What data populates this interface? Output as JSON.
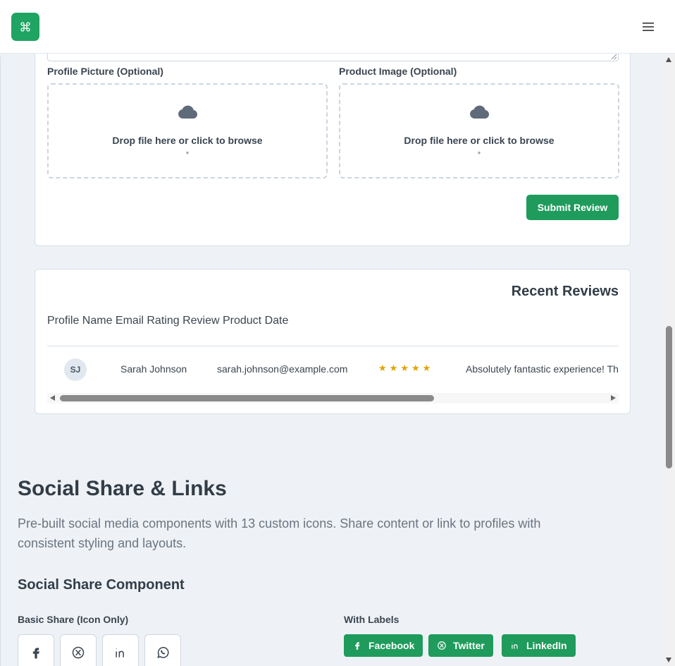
{
  "header": {
    "logo_icon": "command-icon",
    "menu_icon": "hamburger-menu-icon"
  },
  "uploads": [
    {
      "label": "Profile Picture (Optional)",
      "prompt": "Drop file here or click to browse",
      "hint": "*"
    },
    {
      "label": "Product Image (Optional)",
      "prompt": "Drop file here or click to browse",
      "hint": "*"
    }
  ],
  "form": {
    "submit_label": "Submit Review"
  },
  "reviews": {
    "title": "Recent Reviews",
    "header_text": "Profile Name Email Rating Review Product Date",
    "rows": [
      {
        "initials": "SJ",
        "name": "Sarah Johnson",
        "email": "sarah.johnson@example.com",
        "rating": 5,
        "review": "Absolutely fantastic experience! The"
      }
    ]
  },
  "social": {
    "title": "Social Share & Links",
    "description": "Pre-built social media components with 13 custom icons. Share content or link to profiles with consistent styling and layouts.",
    "component_title": "Social Share Component",
    "basic_label": "Basic Share (Icon Only)",
    "labels_label": "With Labels",
    "basic_icons": [
      "facebook-icon",
      "x-twitter-icon",
      "linkedin-icon",
      "whatsapp-icon"
    ],
    "labeled_buttons": [
      {
        "label": "Facebook",
        "icon": "facebook-icon"
      },
      {
        "label": "Twitter",
        "icon": "x-twitter-icon"
      },
      {
        "label": "LinkedIn",
        "icon": "linkedin-icon"
      }
    ]
  },
  "colors": {
    "accent": "#1f9b5c",
    "star": "#e0a400",
    "background": "#eef2f6"
  }
}
